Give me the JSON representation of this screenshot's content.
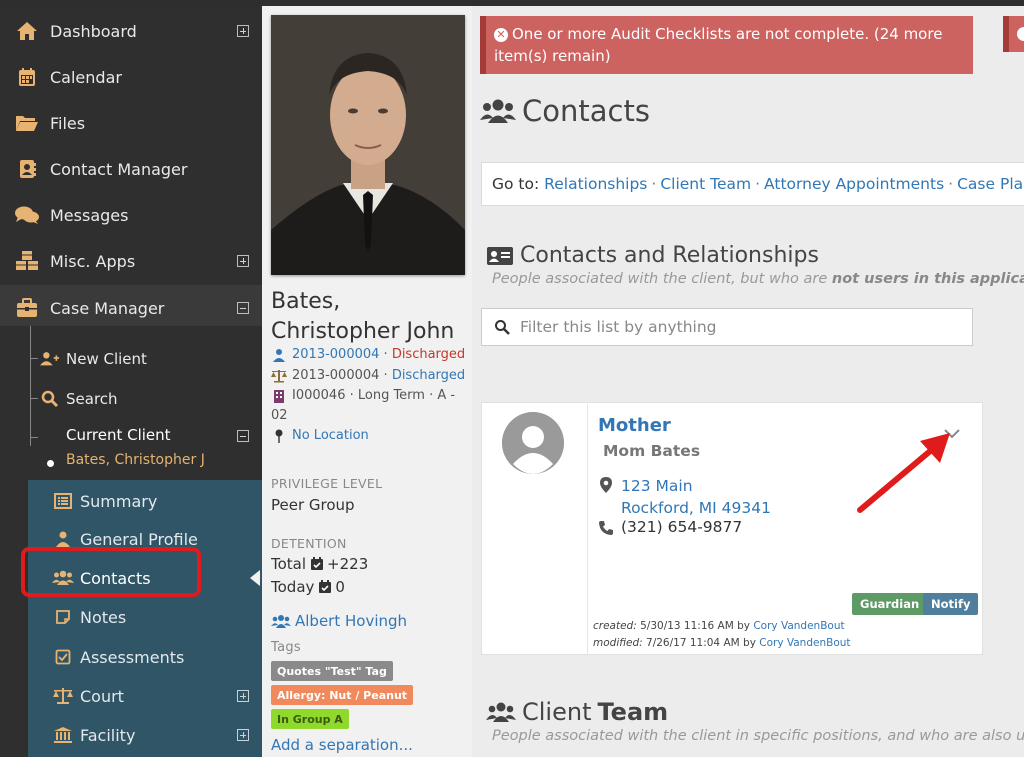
{
  "sidebar": {
    "items": [
      {
        "label": "Dashboard",
        "icon": "home-icon"
      },
      {
        "label": "Calendar",
        "icon": "calendar-icon"
      },
      {
        "label": "Files",
        "icon": "folder-icon"
      },
      {
        "label": "Contact Manager",
        "icon": "address-book-icon"
      },
      {
        "label": "Messages",
        "icon": "comments-icon"
      },
      {
        "label": "Misc. Apps",
        "icon": "cubes-icon"
      },
      {
        "label": "Case Manager",
        "icon": "briefcase-icon"
      }
    ],
    "case_manager_sub": [
      {
        "label": "New Client",
        "icon": "user-plus-icon"
      },
      {
        "label": "Search",
        "icon": "search-icon"
      }
    ],
    "current_client": {
      "title": "Current Client",
      "name": "Bates, Christopher J"
    },
    "client_items": [
      {
        "label": "Summary",
        "icon": "list-icon"
      },
      {
        "label": "General Profile",
        "icon": "user-icon"
      },
      {
        "label": "Contacts",
        "icon": "users-icon"
      },
      {
        "label": "Notes",
        "icon": "note-icon"
      },
      {
        "label": "Assessments",
        "icon": "check-square-icon"
      },
      {
        "label": "Court",
        "icon": "balance-scale-icon"
      },
      {
        "label": "Facility",
        "icon": "building-columns-icon"
      }
    ]
  },
  "profile": {
    "name_line1": "Bates,",
    "name_line2": "Christopher John",
    "case1_number": "2013-000004",
    "case1_status": "Discharged",
    "case2_number": "2013-000004",
    "case2_status": "Discharged",
    "facility_line1": "I000046 · Long Term · A -",
    "facility_line2": "02",
    "location": "No Location",
    "privilege_label": "PRIVILEGE LEVEL",
    "privilege_value": "Peer Group",
    "detention_label": "DETENTION",
    "detention_total_label": "Total",
    "detention_total_value": "+223",
    "detention_today_label": "Today",
    "detention_today_value": "0",
    "caseworker": "Albert Hovingh",
    "tags_label": "Tags",
    "tags": [
      {
        "text": "Quotes \"Test\" Tag",
        "color": "#8a8a8a"
      },
      {
        "text": "Allergy: Nut / Peanut",
        "color": "#f08a5d"
      },
      {
        "text": "In Group A",
        "color": "#8fd82c"
      }
    ],
    "add_separation": "Add a separation..."
  },
  "alert": {
    "text": "One or more Audit Checklists are not complete. (24 more item(s) remain)"
  },
  "main": {
    "title": "Contacts",
    "goto_prefix": "Go to:",
    "goto_links": [
      "Relationships",
      "Client Team",
      "Attorney Appointments",
      "Case Plan Con"
    ],
    "section_title": "Contacts and Relationships",
    "section_sub_pre": "People associated with the client, but who are",
    "section_sub_bold": "not users in this application",
    "section_sub_post": ".",
    "filter_placeholder": "Filter this list by anything",
    "contact": {
      "role": "Mother",
      "name": "Mom Bates",
      "address_line1": "123 Main",
      "address_line2": "Rockford, MI 49341",
      "phone": "(321) 654-9877",
      "badges": [
        {
          "text": "Guardian",
          "color": "#5e9a65"
        },
        {
          "text": "Notify",
          "color": "#4f7f9c"
        }
      ],
      "created_label": "created:",
      "created_value": "5/30/13 11:16 AM by",
      "created_by": "Cory VandenBout",
      "modified_label": "modified:",
      "modified_value": "7/26/17 11:04 AM by",
      "modified_by": "Cory VandenBout"
    },
    "team_title_pre": "Client",
    "team_title_bold": "Team",
    "team_sub": "People associated with the client in specific positions, and who are also users w"
  }
}
